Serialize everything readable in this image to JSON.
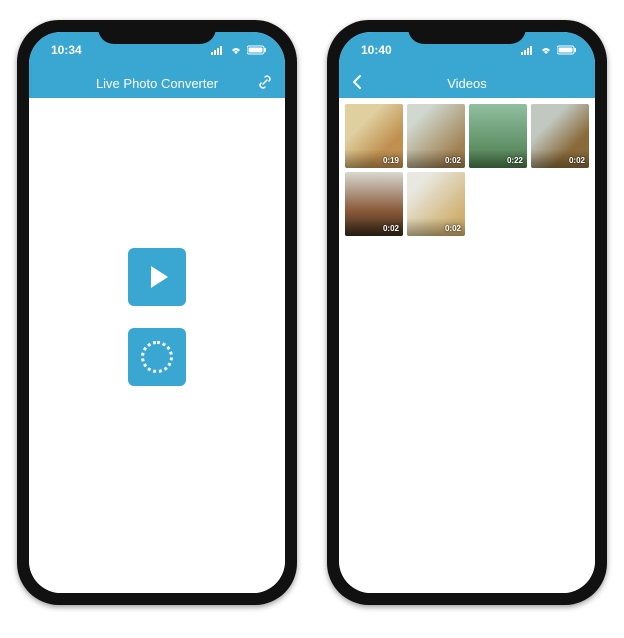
{
  "accent_color": "#39a7d1",
  "phone_left": {
    "status": {
      "time": "10:34"
    },
    "nav": {
      "title": "Live Photo Converter"
    }
  },
  "phone_right": {
    "status": {
      "time": "10:40"
    },
    "nav": {
      "title": "Videos"
    },
    "videos": [
      {
        "duration": "0:19"
      },
      {
        "duration": "0:02"
      },
      {
        "duration": "0:22"
      },
      {
        "duration": "0:02"
      },
      {
        "duration": "0:02"
      },
      {
        "duration": "0:02"
      }
    ]
  }
}
